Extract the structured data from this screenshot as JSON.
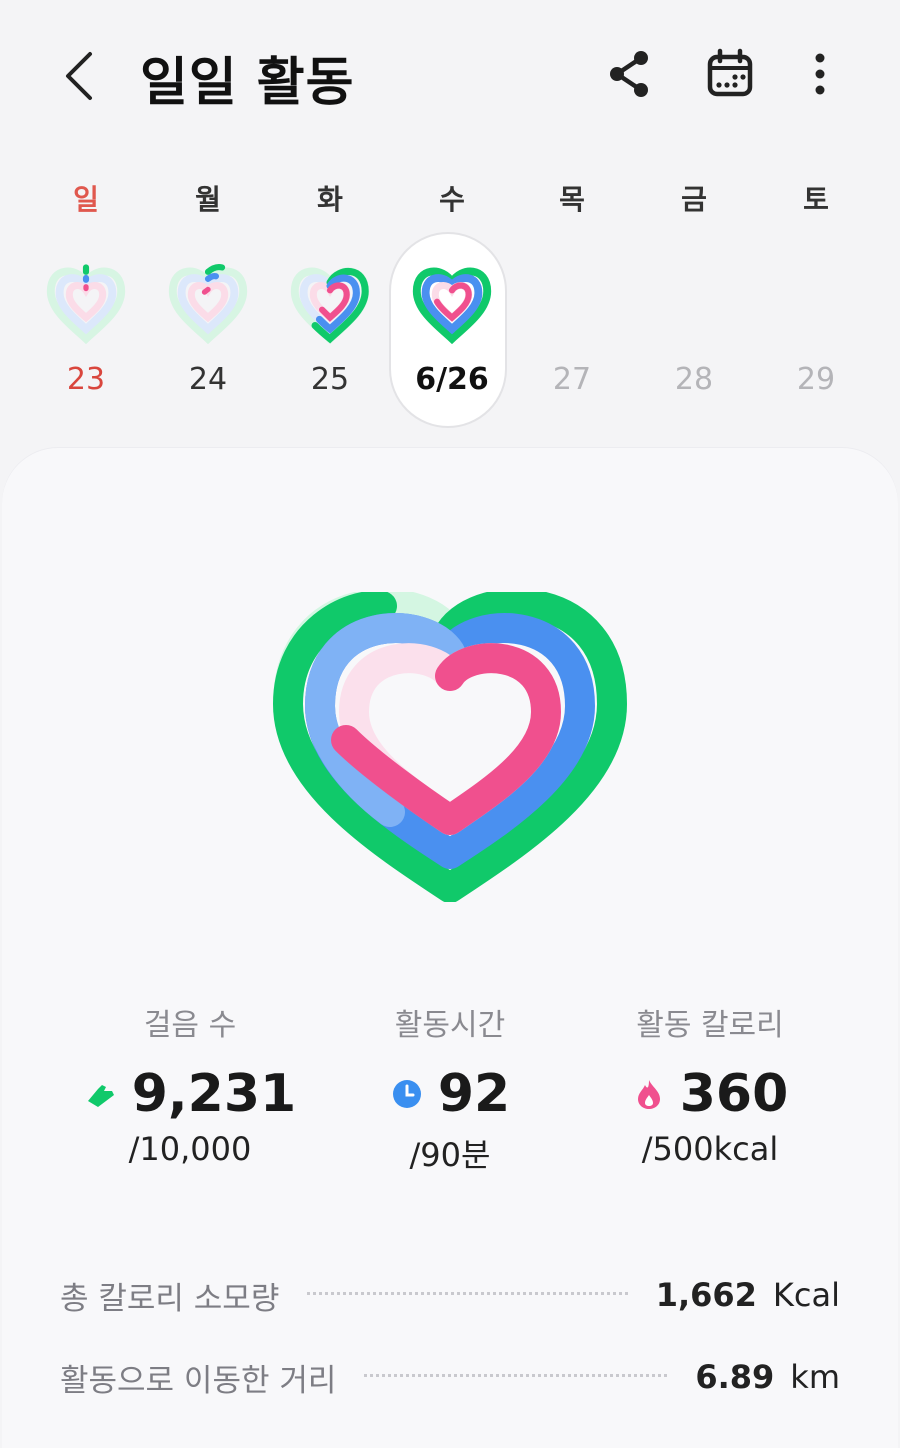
{
  "header": {
    "title": "일일 활동",
    "back_icon": "chevron-left-icon",
    "share_icon": "share-icon",
    "calendar_icon": "calendar-icon",
    "more_icon": "more-vertical-icon"
  },
  "week": [
    {
      "dow": "일",
      "date": "23",
      "sunday": true,
      "state": "past"
    },
    {
      "dow": "월",
      "date": "24",
      "state": "past"
    },
    {
      "dow": "화",
      "date": "25",
      "state": "past"
    },
    {
      "dow": "수",
      "date": "6/26",
      "state": "selected"
    },
    {
      "dow": "목",
      "date": "27",
      "state": "future"
    },
    {
      "dow": "금",
      "date": "28",
      "state": "future"
    },
    {
      "dow": "토",
      "date": "29",
      "state": "future"
    }
  ],
  "rings": {
    "steps_progress": 0.92,
    "active_time_progress": 1.0,
    "calories_progress": 0.72,
    "colors": {
      "steps": "#10c96a",
      "active_time": "#4a90f0",
      "calories": "#f0508e"
    }
  },
  "stats": {
    "steps": {
      "label": "걸음 수",
      "value": "9,231",
      "goal": "/10,000",
      "icon": "shoe-icon"
    },
    "active_time": {
      "label": "활동시간",
      "value": "92",
      "goal": "/90분",
      "icon": "clock-icon"
    },
    "calories": {
      "label": "활동 칼로리",
      "value": "360",
      "goal": "/500kcal",
      "icon": "flame-icon"
    }
  },
  "summary": [
    {
      "label": "총 칼로리 소모량",
      "value": "1,662",
      "unit": "Kcal"
    },
    {
      "label": "활동으로 이동한 거리",
      "value": "6.89",
      "unit": "km"
    }
  ]
}
